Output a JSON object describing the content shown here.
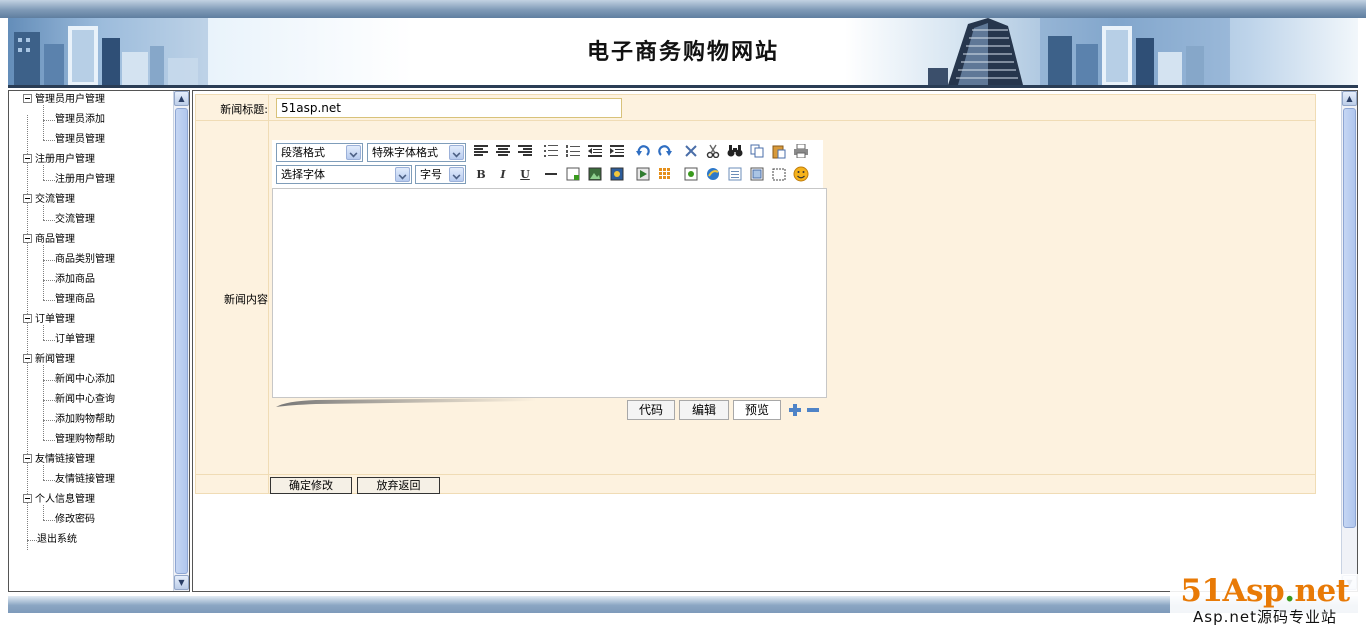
{
  "header": {
    "site_title": "电子商务购物网站"
  },
  "sidebar": {
    "groups": [
      {
        "label": "管理员用户管理",
        "items": [
          "管理员添加",
          "管理员管理"
        ]
      },
      {
        "label": "注册用户管理",
        "items": [
          "注册用户管理"
        ]
      },
      {
        "label": "交流管理",
        "items": [
          "交流管理"
        ]
      },
      {
        "label": "商品管理",
        "items": [
          "商品类别管理",
          "添加商品",
          "管理商品"
        ]
      },
      {
        "label": "订单管理",
        "items": [
          "订单管理"
        ]
      },
      {
        "label": "新闻管理",
        "items": [
          "新闻中心添加",
          "新闻中心查询",
          "添加购物帮助",
          "管理购物帮助"
        ]
      },
      {
        "label": "友情链接管理",
        "items": [
          "友情链接管理"
        ]
      },
      {
        "label": "个人信息管理",
        "items": [
          "修改密码"
        ]
      }
    ],
    "logout": "退出系统"
  },
  "form": {
    "title_label": "新闻标题:",
    "title_value": "51asp.net",
    "content_label": "新闻内容",
    "submit_label": "确定修改",
    "cancel_label": "放弃返回"
  },
  "editor": {
    "paragraph_format": "段落格式",
    "special_format": "特殊字体格式",
    "font_family": "选择字体",
    "font_size": "字号",
    "bold": "B",
    "italic": "I",
    "underline": "U",
    "modes": [
      "代码",
      "编辑",
      "预览"
    ]
  },
  "watermark": {
    "logo_main": "51Asp",
    "logo_dot": ".",
    "logo_tld": "net",
    "tagline": "Asp.net源码专业站"
  },
  "colors": {
    "form_bg": "#fdf2df",
    "header_bar": "#7f9ab7",
    "logo_orange": "#e87a06",
    "logo_green": "#3a9a1e"
  }
}
